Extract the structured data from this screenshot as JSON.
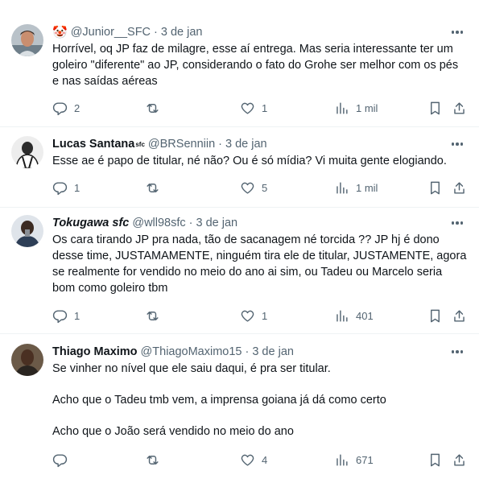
{
  "tweets": [
    {
      "name_emoji": "🤡",
      "display_name": "",
      "handle": "@Junior__SFC",
      "dot": "·",
      "date": "3 de jan",
      "text": [
        "Horrível, oq JP faz de milagre, esse aí entrega. Mas seria interessante ter um goleiro \"diferente\" ao JP, considerando o fato do Grohe ser melhor com os pés e nas saídas aéreas"
      ],
      "replies": "2",
      "retweets": "",
      "likes": "1",
      "views": "1 mil"
    },
    {
      "display_name": "Lucas Santana",
      "name_suffix": "sfc",
      "handle": "@BRSenniin",
      "dot": "·",
      "date": "3 de jan",
      "text": [
        "Esse ae é papo de titular, né não? Ou é só mídia? Vi muita gente elogiando."
      ],
      "replies": "1",
      "retweets": "",
      "likes": "5",
      "views": "1 mil"
    },
    {
      "display_name": "Tokugawa sfc",
      "handle": "@wll98sfc",
      "dot": "·",
      "date": "3 de jan",
      "text": [
        "Os cara tirando JP pra nada, tão de sacanagem né torcida ?? JP hj é dono desse time, JUSTAMAMENTE, ninguém tira ele de titular, JUSTAMENTE, agora se realmente for vendido no meio do ano ai sim, ou Tadeu ou Marcelo seria bom como goleiro tbm"
      ],
      "replies": "1",
      "retweets": "",
      "likes": "1",
      "views": "401"
    },
    {
      "display_name": "Thiago Maximo",
      "handle": "@ThiagoMaximo15",
      "dot": "·",
      "date": "3 de jan",
      "text": [
        "Se vinher no nível que ele saiu daqui,  é pra ser titular.",
        "Acho que o Tadeu tmb vem, a imprensa goiana já dá como certo",
        "Acho que o João será vendido no meio do ano"
      ],
      "replies": "",
      "retweets": "",
      "likes": "4",
      "views": "671"
    }
  ],
  "icons": {
    "reply": "reply-icon",
    "retweet": "retweet-icon",
    "like": "heart-icon",
    "views": "views-icon",
    "bookmark": "bookmark-icon",
    "share": "share-icon",
    "more": "more-icon"
  },
  "colors": {
    "text": "#0f1419",
    "muted": "#536471",
    "border": "#eff3f4"
  }
}
